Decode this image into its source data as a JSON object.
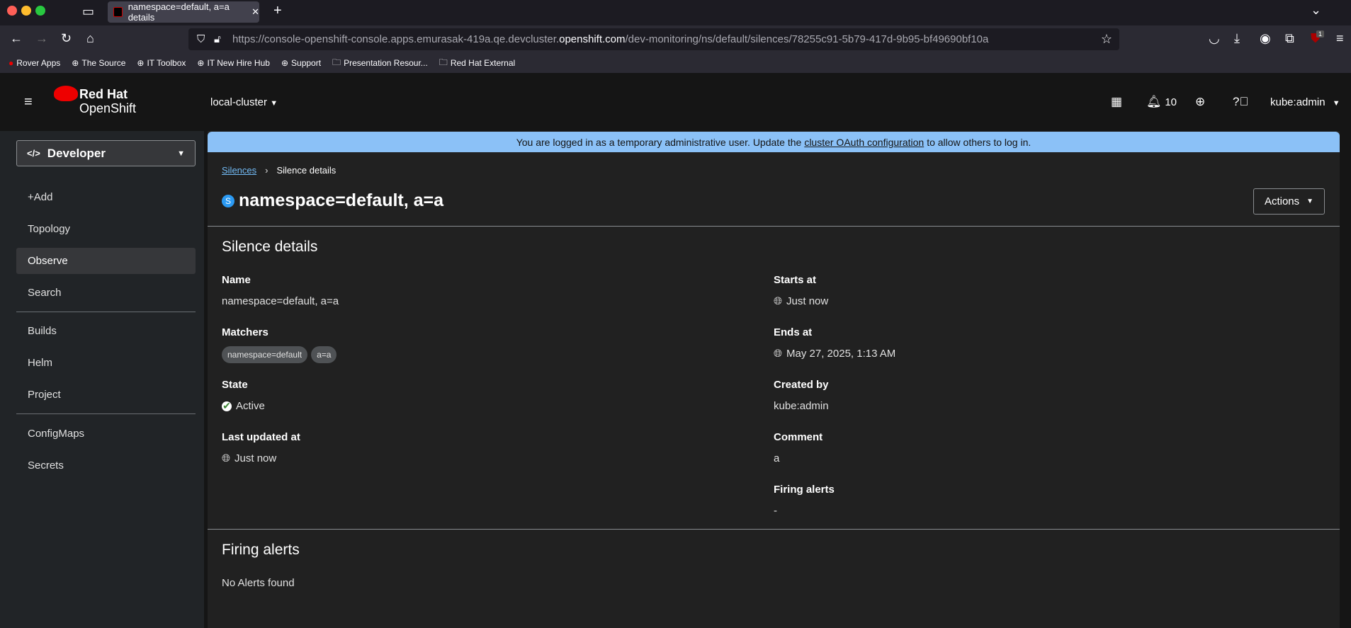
{
  "browser": {
    "tab_title": "namespace=default, a=a details",
    "url_prefix": "https://console-openshift-console.apps.emurasak-419a.qe.devcluster.",
    "url_domain": "openshift.com",
    "url_suffix": "/dev-monitoring/ns/default/silences/78255c91-5b79-417d-9b95-bf49690bf10a",
    "extension_badge": "1",
    "bookmarks": [
      {
        "label": "Rover Apps",
        "icon": "redhat-icon"
      },
      {
        "label": "The Source",
        "icon": "globe-icon"
      },
      {
        "label": "IT Toolbox",
        "icon": "globe-icon"
      },
      {
        "label": "IT New Hire Hub",
        "icon": "globe-icon"
      },
      {
        "label": "Support",
        "icon": "globe-icon"
      },
      {
        "label": "Presentation Resour...",
        "icon": "folder-icon"
      },
      {
        "label": "Red Hat External",
        "icon": "folder-icon"
      }
    ]
  },
  "header": {
    "brand_line1": "Red Hat",
    "brand_line2": "OpenShift",
    "cluster": "local-cluster",
    "notifications": "10",
    "user": "kube:admin"
  },
  "sidebar": {
    "perspective": "Developer",
    "items": [
      "+Add",
      "Topology",
      "Observe",
      "Search",
      "Builds",
      "Helm",
      "Project",
      "ConfigMaps",
      "Secrets"
    ],
    "active": "Observe"
  },
  "banner": {
    "before": "You are logged in as a temporary administrative user. Update the ",
    "link": "cluster OAuth configuration",
    "after": " to allow others to log in."
  },
  "breadcrumb": {
    "parent": "Silences",
    "current": "Silence details"
  },
  "page": {
    "badge": "S",
    "title": "namespace=default, a=a",
    "actions": "Actions"
  },
  "details": {
    "heading": "Silence details",
    "name_label": "Name",
    "name": "namespace=default, a=a",
    "matchers_label": "Matchers",
    "matchers": [
      "namespace=default",
      "a=a"
    ],
    "state_label": "State",
    "state": "Active",
    "updated_label": "Last updated at",
    "updated": "Just now",
    "starts_label": "Starts at",
    "starts": "Just now",
    "ends_label": "Ends at",
    "ends": "May 27, 2025, 1:13 AM",
    "created_label": "Created by",
    "created": "kube:admin",
    "comment_label": "Comment",
    "comment": "a",
    "firing_label": "Firing alerts",
    "firing": "-"
  },
  "firing": {
    "heading": "Firing alerts",
    "empty": "No Alerts found"
  },
  "colors": {
    "banner": "#8bc1f7",
    "active": "#3e8635",
    "badge": "#2b9af3"
  }
}
